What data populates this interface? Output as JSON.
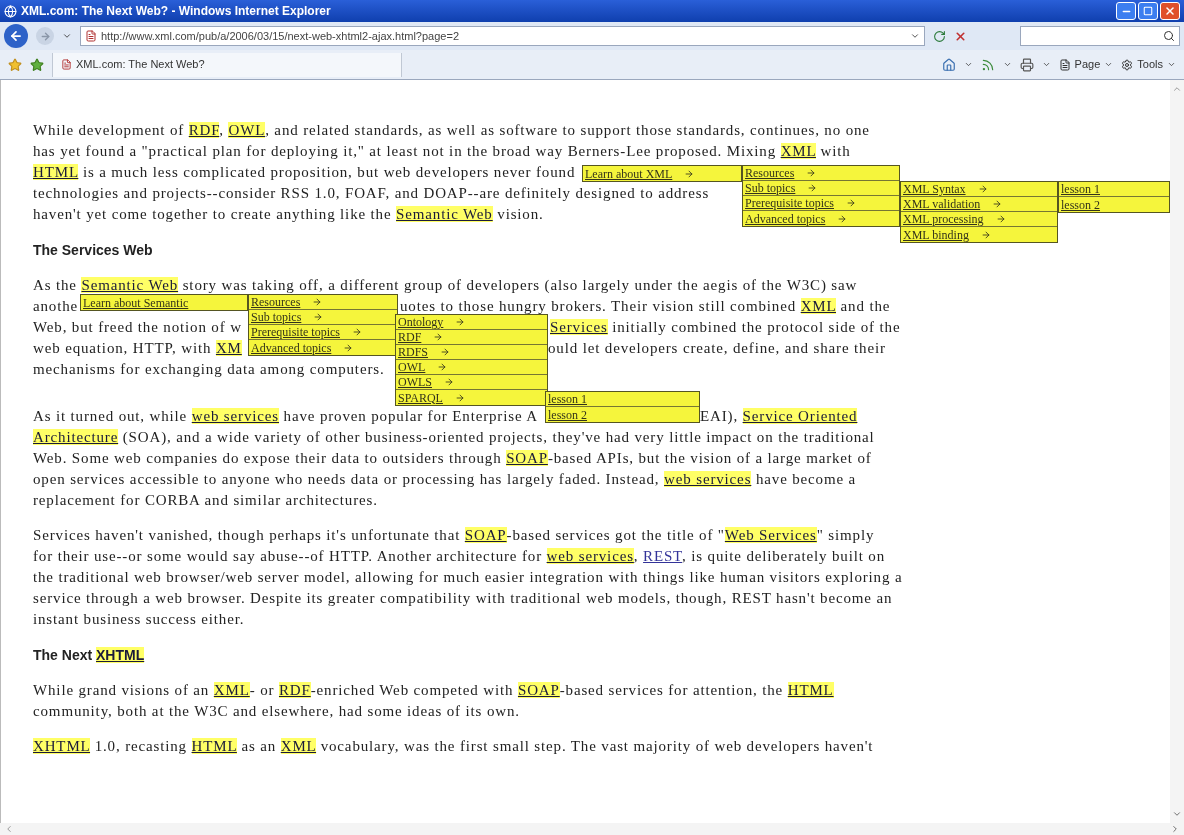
{
  "browser": {
    "title": "XML.com: The Next Web? - Windows Internet Explorer",
    "url": "http://www.xml.com/pub/a/2006/03/15/next-web-xhtml2-ajax.html?page=2",
    "tab": "XML.com: The Next Web?",
    "toolbar_menus": [
      "Page",
      "Tools"
    ]
  },
  "article": [
    {
      "kind": "paragraph",
      "lines": [
        [
          [
            {
              "kind": "text",
              "text": "While development of "
            },
            {
              "kind": "term",
              "text": "RDF"
            },
            {
              "kind": "text",
              "text": ", "
            },
            {
              "kind": "term",
              "text": "OWL"
            },
            {
              "kind": "text",
              "text": ", and related standards, as well as software to support those standards, continues, no one"
            }
          ]
        ],
        [
          [
            {
              "kind": "text",
              "text": "has yet found a \"practical plan for deploying it,\" at least not in the broad way Berners-Lee proposed. Mixing "
            },
            {
              "kind": "term",
              "text": "XML"
            },
            {
              "kind": "text",
              "text": " with"
            }
          ]
        ],
        [
          [
            {
              "kind": "term",
              "text": "HTML"
            },
            {
              "kind": "text",
              "text": " is a much less complicated proposition, but web developers never found"
            }
          ]
        ],
        [
          [
            {
              "kind": "text",
              "text": "technologies and projects--consider RSS 1.0, FOAF, and DOAP--are definitely designed to address"
            }
          ]
        ],
        [
          [
            {
              "kind": "text",
              "text": "haven't yet come together to create anything like the "
            },
            {
              "kind": "term",
              "text": "Semantic Web"
            },
            {
              "kind": "text",
              "text": " vision."
            }
          ]
        ]
      ]
    },
    {
      "kind": "heading",
      "lines": [
        [
          [
            {
              "kind": "text",
              "text": "The Services Web"
            }
          ]
        ]
      ]
    },
    {
      "kind": "paragraph",
      "lines": [
        [
          [
            {
              "kind": "text",
              "text": "As the "
            },
            {
              "kind": "term",
              "text": "Semantic Web"
            },
            {
              "kind": "text",
              "text": " story was taking off, a different group of developers (also largely under the aegis of the W3C) saw"
            }
          ]
        ],
        [
          [
            {
              "kind": "text",
              "text": "anothe"
            }
          ],
          [
            {
              "kind": "text",
              "text": "uotes to those hungry brokers. Their vision still combined "
            },
            {
              "kind": "term",
              "text": "XML"
            },
            {
              "kind": "text",
              "text": " and the"
            }
          ]
        ],
        [
          [
            {
              "kind": "text",
              "text": "Web, but freed the notion of w"
            }
          ],
          [
            {
              "kind": "term",
              "text": "Services"
            },
            {
              "kind": "text",
              "text": " initially combined the protocol side of the"
            }
          ]
        ],
        [
          [
            {
              "kind": "text",
              "text": "web equation, HTTP, with "
            },
            {
              "kind": "term",
              "text": "XM"
            }
          ],
          [
            {
              "kind": "text",
              "text": "ould let developers create, define, and share their"
            }
          ]
        ],
        [
          [
            {
              "kind": "text",
              "text": "mechanisms for exchanging data among computers."
            }
          ]
        ]
      ]
    },
    {
      "kind": "paragraph",
      "lines": [
        [
          [
            {
              "kind": "text",
              "text": "As it turned out, while "
            },
            {
              "kind": "term",
              "text": "web services"
            },
            {
              "kind": "text",
              "text": " have proven popular for Enterprise A"
            }
          ],
          [
            {
              "kind": "text",
              "text": "EAI), "
            },
            {
              "kind": "term",
              "text": "Service Oriented"
            }
          ]
        ],
        [
          [
            {
              "kind": "term",
              "text": "Architecture"
            },
            {
              "kind": "text",
              "text": " (SOA), and a wide variety of other business-oriented projects, they've had very little impact on the traditional"
            }
          ]
        ],
        [
          [
            {
              "kind": "text",
              "text": "Web. Some web companies do expose their data to outsiders through "
            },
            {
              "kind": "term",
              "text": "SOAP"
            },
            {
              "kind": "text",
              "text": "-based APIs, but the vision of a large market of"
            }
          ]
        ],
        [
          [
            {
              "kind": "text",
              "text": "open services accessible to anyone who needs data or processing has largely faded. Instead, "
            },
            {
              "kind": "term",
              "text": "web services"
            },
            {
              "kind": "text",
              "text": " have become a"
            }
          ]
        ],
        [
          [
            {
              "kind": "text",
              "text": "replacement for CORBA and similar architectures."
            }
          ]
        ]
      ]
    },
    {
      "kind": "paragraph",
      "lines": [
        [
          [
            {
              "kind": "text",
              "text": "Services haven't vanished, though perhaps it's unfortunate that "
            },
            {
              "kind": "term",
              "text": "SOAP"
            },
            {
              "kind": "text",
              "text": "-based services got the title of \""
            },
            {
              "kind": "term",
              "text": "Web Services"
            },
            {
              "kind": "text",
              "text": "\" simply"
            }
          ]
        ],
        [
          [
            {
              "kind": "text",
              "text": "for their use--or some would say abuse--of HTTP. Another architecture for "
            },
            {
              "kind": "term",
              "text": "web services"
            },
            {
              "kind": "text",
              "text": ", "
            },
            {
              "kind": "link",
              "text": "REST"
            },
            {
              "kind": "text",
              "text": ", is quite deliberately built on"
            }
          ]
        ],
        [
          [
            {
              "kind": "text",
              "text": "the traditional web browser/web server model, allowing for much easier integration with things like human visitors exploring a"
            }
          ]
        ],
        [
          [
            {
              "kind": "text",
              "text": "service through a web browser. Despite its greater compatibility with traditional web models, though, REST hasn't become an"
            }
          ]
        ],
        [
          [
            {
              "kind": "text",
              "text": "instant business success either."
            }
          ]
        ]
      ]
    },
    {
      "kind": "heading",
      "lines": [
        [
          [
            {
              "kind": "text",
              "text": "The Next "
            },
            {
              "kind": "term",
              "text": "XHTML"
            }
          ]
        ]
      ]
    },
    {
      "kind": "paragraph",
      "lines": [
        [
          [
            {
              "kind": "text",
              "text": "While grand visions of an "
            },
            {
              "kind": "term",
              "text": "XML"
            },
            {
              "kind": "text",
              "text": "- or "
            },
            {
              "kind": "term",
              "text": "RDF"
            },
            {
              "kind": "text",
              "text": "-enriched Web competed with "
            },
            {
              "kind": "term",
              "text": "SOAP"
            },
            {
              "kind": "text",
              "text": "-based services for attention, the "
            },
            {
              "kind": "term",
              "text": "HTML"
            }
          ]
        ],
        [
          [
            {
              "kind": "text",
              "text": "community, both at the W3C and elsewhere, had some ideas of its own."
            }
          ]
        ]
      ]
    },
    {
      "kind": "paragraph",
      "lines": [
        [
          [
            {
              "kind": "term",
              "text": "XHTML"
            },
            {
              "kind": "text",
              "text": " 1.0, recasting "
            },
            {
              "kind": "term",
              "text": "HTML"
            },
            {
              "kind": "text",
              "text": " as an "
            },
            {
              "kind": "term",
              "text": "XML"
            },
            {
              "kind": "text",
              "text": " vocabulary, was the first small step. The vast majority of web developers haven't"
            }
          ]
        ]
      ]
    }
  ],
  "popup_menus": [
    {
      "columns": [
        {
          "items": [
            {
              "label": "Learn about XML",
              "submenu": true
            }
          ]
        },
        {
          "items": [
            {
              "label": "Resources",
              "submenu": true
            },
            {
              "label": "Sub topics",
              "submenu": true
            },
            {
              "label": "Prerequisite topics",
              "submenu": true
            },
            {
              "label": "Advanced topics",
              "submenu": true
            }
          ]
        },
        {
          "items": [
            {
              "label": "XML Syntax",
              "submenu": true
            },
            {
              "label": "XML validation",
              "submenu": true
            },
            {
              "label": "XML processing",
              "submenu": true
            },
            {
              "label": "XML binding",
              "submenu": true
            }
          ]
        },
        {
          "items": [
            {
              "label": "lesson 1",
              "submenu": false
            },
            {
              "label": "lesson 2",
              "submenu": false
            }
          ]
        }
      ]
    },
    {
      "columns": [
        {
          "items": [
            {
              "label": "Learn about Semantic",
              "submenu": false
            }
          ]
        },
        {
          "items": [
            {
              "label": "Resources",
              "submenu": true
            },
            {
              "label": "Sub topics",
              "submenu": true
            },
            {
              "label": "Prerequisite topics",
              "submenu": true
            },
            {
              "label": "Advanced topics",
              "submenu": true
            }
          ]
        },
        {
          "items": [
            {
              "label": "Ontology",
              "submenu": true
            },
            {
              "label": "RDF",
              "submenu": true
            },
            {
              "label": "RDFS",
              "submenu": true
            },
            {
              "label": "OWL",
              "submenu": true
            },
            {
              "label": "OWLS",
              "submenu": true
            },
            {
              "label": "SPARQL",
              "submenu": true
            }
          ]
        },
        {
          "items": [
            {
              "label": "lesson 1",
              "submenu": false
            },
            {
              "label": "lesson 2",
              "submenu": false
            }
          ]
        }
      ]
    }
  ]
}
